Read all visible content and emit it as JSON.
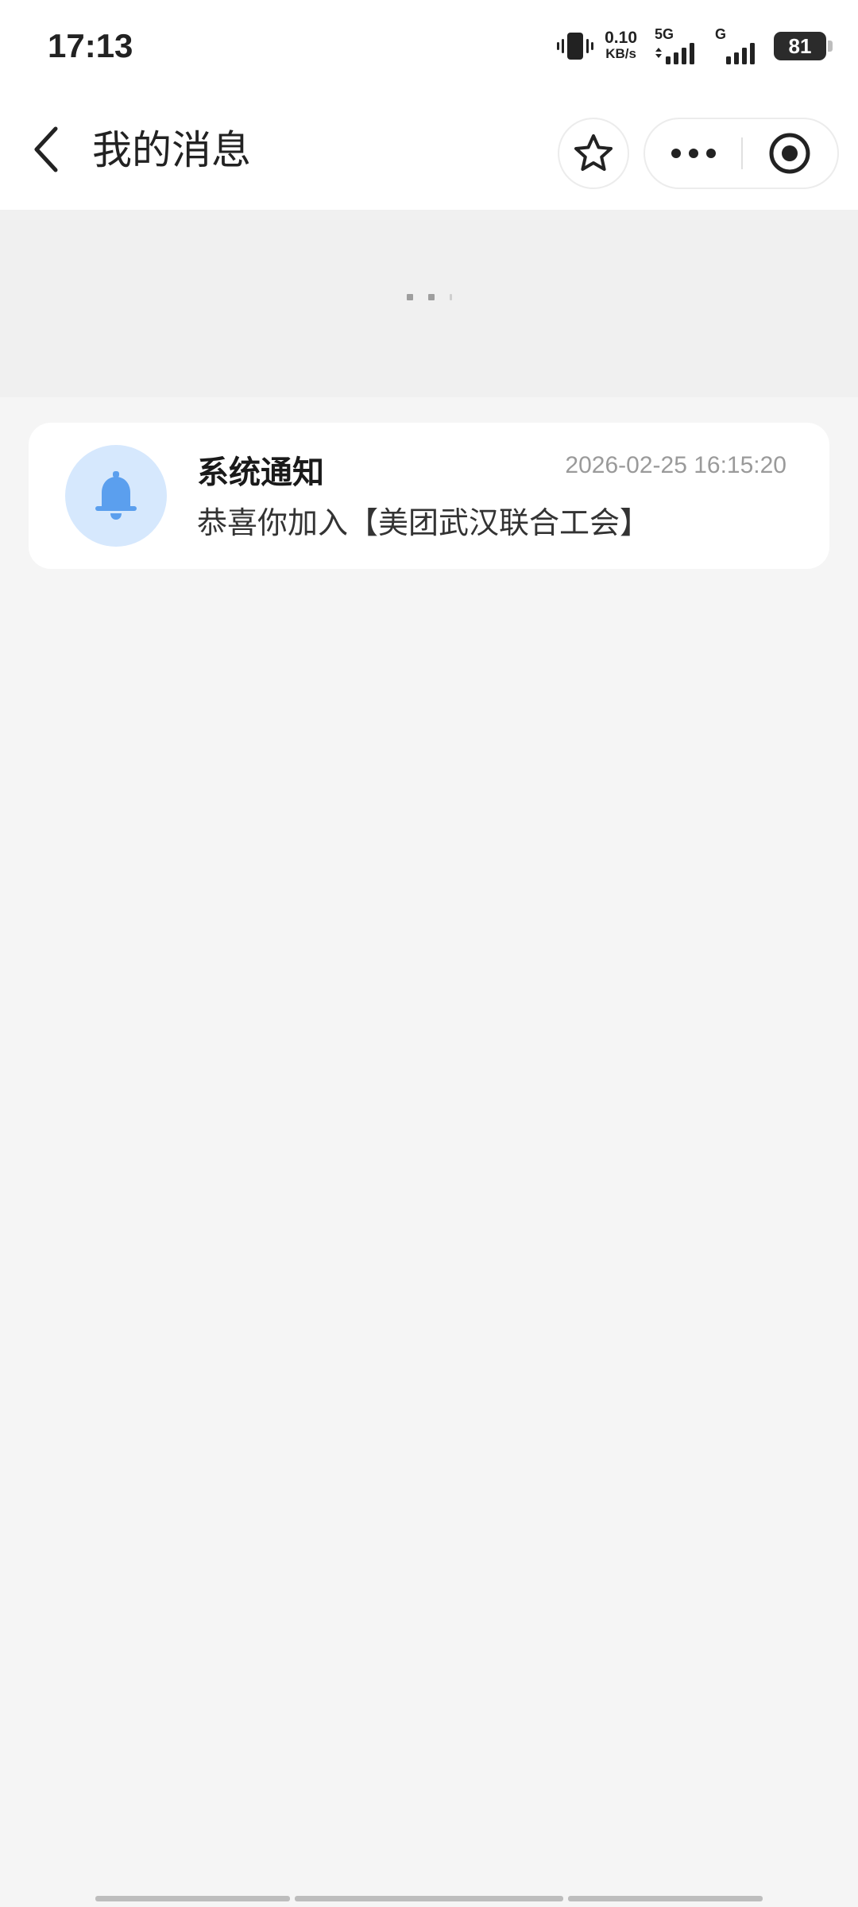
{
  "status_bar": {
    "time": "17:13",
    "net_speed_value": "0.10",
    "net_speed_unit": "KB/s",
    "sim1_tag": "5G",
    "sim2_tag": "G",
    "battery_level": "81",
    "icons": [
      "vibrate-icon",
      "signal-5g-icon",
      "signal-g-icon",
      "battery-icon"
    ]
  },
  "header": {
    "title": "我的消息",
    "icons": [
      "back-arrow-icon",
      "star-icon",
      "more-dots-icon",
      "close-target-icon"
    ]
  },
  "messages": [
    {
      "title": "系统通知",
      "time": "2026-02-25 16:15:20",
      "body": "恭喜你加入【美团武汉联合工会】",
      "icon": "bell-icon",
      "avatar_bg": "#d6e8fd",
      "icon_color": "#5b9fee"
    }
  ],
  "colors": {
    "page_bg": "#f5f5f5",
    "loading_bg": "#f0f0f0",
    "card_bg": "#ffffff",
    "time_text": "#9a9a9a"
  }
}
